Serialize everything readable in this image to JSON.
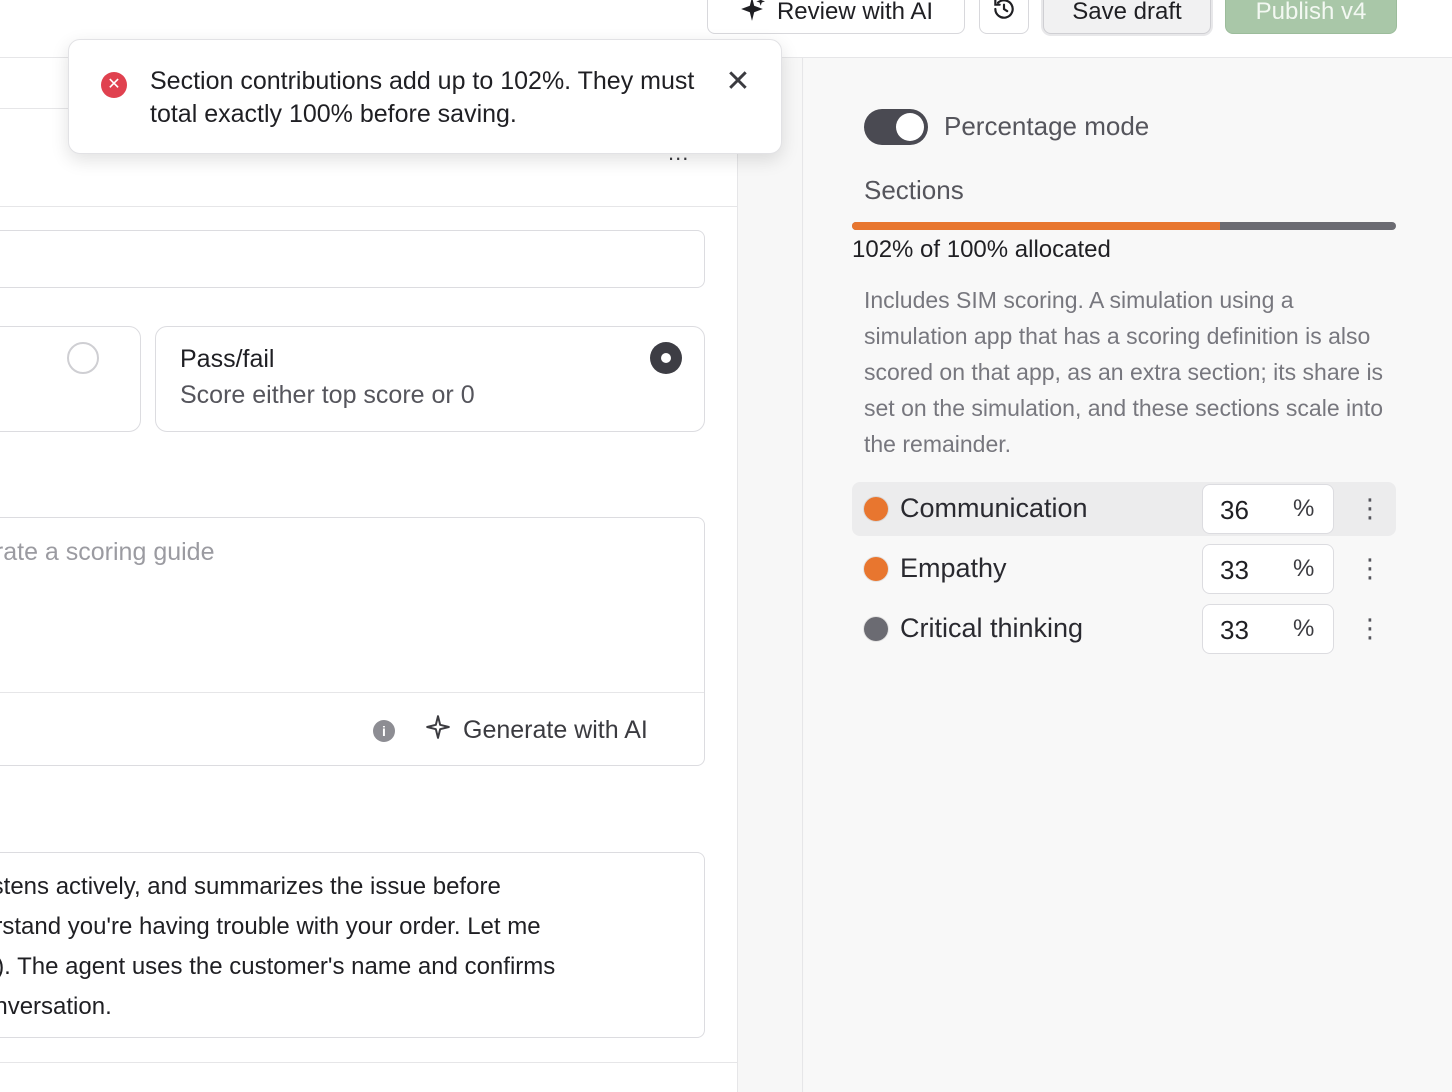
{
  "header": {
    "review_label": "Review with AI",
    "save_label": "Save draft",
    "publish_label": "Publish v4"
  },
  "toast": {
    "message": "Section contributions add up to 102%. They must total exactly 100% before saving."
  },
  "editor": {
    "more_label": "...",
    "scoring_options": [
      {
        "title": "",
        "subtitle": "",
        "selected": false
      },
      {
        "title": "Pass/fail",
        "subtitle": "Score either top score or 0",
        "selected": true
      }
    ],
    "guide_placeholder": "erate a scoring guide",
    "generate_label": "Generate with AI",
    "description_lines": [
      "listens actively, and summarizes the issue before",
      "erstand you're having trouble with your order. Let me",
      ".\"). The agent uses the customer's name and confirms",
      "onversation."
    ]
  },
  "panel": {
    "toggle_label": "Percentage mode",
    "toggle_on": true,
    "sections_label": "Sections",
    "allocation_text": "102% of 100% allocated",
    "allocation_percent": 102,
    "note": "Includes SIM scoring. A simulation using a simulation app that has a scoring definition is also scored on that app, as an extra section; its share is set on the simulation, and these sections scale into the remainder.",
    "percent_symbol": "%",
    "sections": [
      {
        "name": "Communication",
        "value": "36",
        "color": "#e8762f"
      },
      {
        "name": "Empathy",
        "value": "33",
        "color": "#e8762f"
      },
      {
        "name": "Critical thinking",
        "value": "33",
        "color": "#6b6b72"
      }
    ]
  },
  "colors": {
    "accent_orange": "#e8762f",
    "publish_green": "#a9c7a8",
    "error_red": "#e0414f"
  }
}
